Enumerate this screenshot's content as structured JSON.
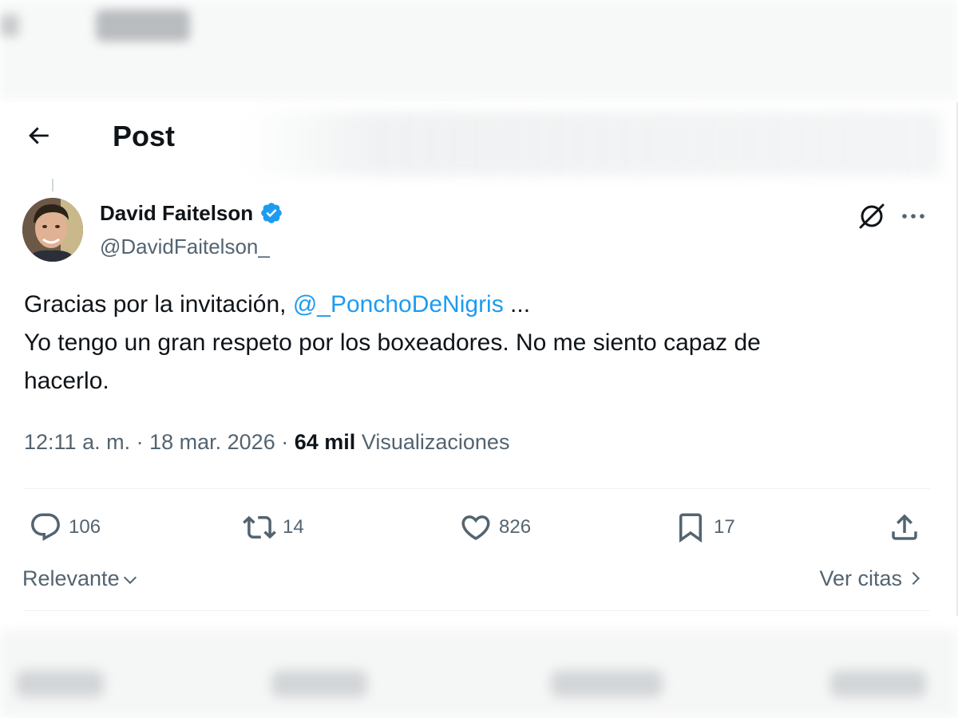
{
  "header": {
    "title": "Post",
    "back_icon": "arrow-left-icon"
  },
  "post": {
    "author": {
      "name": "David Faitelson",
      "handle": "@DavidFaitelson_",
      "verified": true,
      "verified_color": "#1d9bf0"
    },
    "text": {
      "line1_prefix": "Gracias por la invitación, ",
      "mention": "@_PonchoDeNigris",
      "line1_suffix": " ...",
      "line2": "Yo tengo un gran respeto por los boxeadores. No me siento capaz de",
      "line3": "hacerlo."
    },
    "meta": {
      "time": "12:11 a. m.",
      "separator": "·",
      "date": "18 mar. 2026",
      "views_count": "64 mil",
      "views_label": "Visualizaciones"
    },
    "actions": {
      "replies": "106",
      "reposts": "14",
      "likes": "826",
      "bookmarks": "17"
    }
  },
  "footer": {
    "sort_label": "Relevante",
    "quotes_label": "Ver citas"
  },
  "colors": {
    "text": "#0f1419",
    "secondary": "#536471",
    "link": "#1d9bf0",
    "divider": "#eff3f4"
  }
}
